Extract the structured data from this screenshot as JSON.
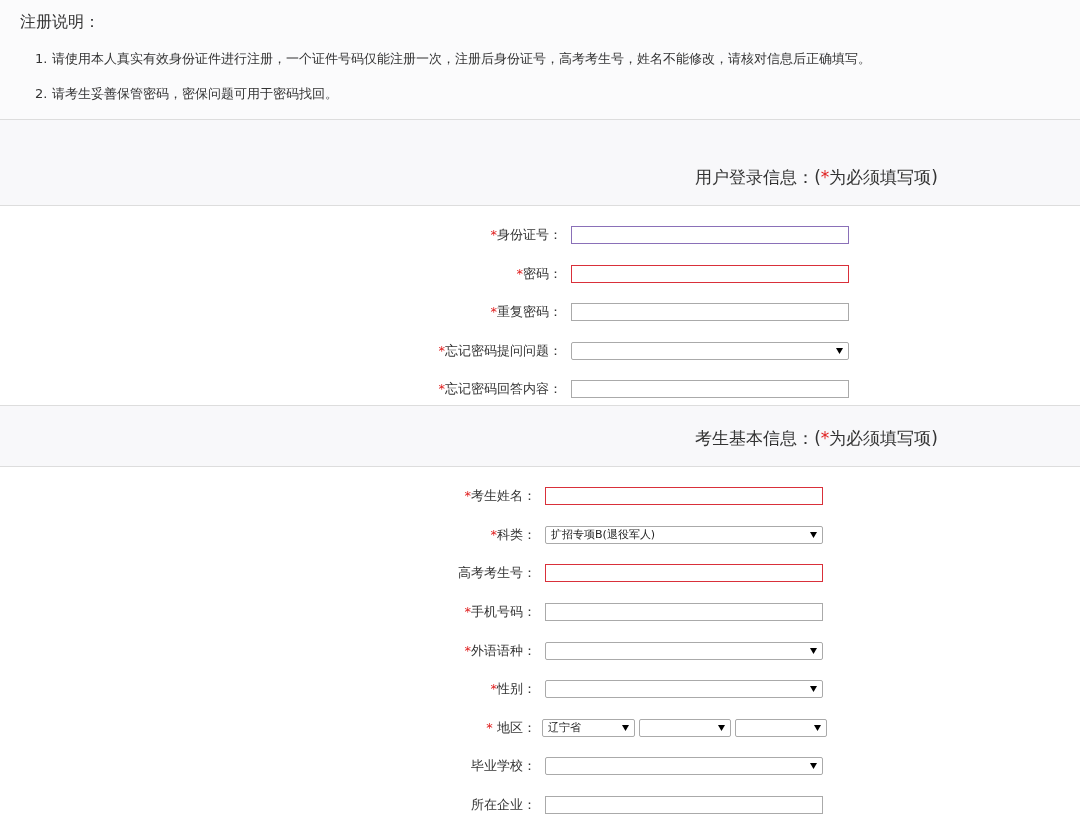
{
  "intro": {
    "title": "注册说明：",
    "items": [
      "1. 请使用本人真实有效身份证件进行注册，一个证件号码仅能注册一次，注册后身份证号，高考考生号，姓名不能修改，请核对信息后正确填写。",
      "2. 请考生妥善保管密码，密保问题可用于密码找回。"
    ]
  },
  "sections": [
    {
      "heading": {
        "prefix": "用户登录信息：(",
        "mark": "*",
        "suffix": "为必须填写项)"
      },
      "fields": [
        {
          "kind": "text",
          "mark": "*",
          "label": "身份证号：",
          "focused": true,
          "invalid": false
        },
        {
          "kind": "text",
          "mark": "*",
          "label": "密码：",
          "focused": false,
          "invalid": true
        },
        {
          "kind": "text",
          "mark": "*",
          "label": "重复密码：",
          "focused": false,
          "invalid": false
        },
        {
          "kind": "select",
          "mark": "*",
          "label": "忘记密码提问问题：",
          "focused": false,
          "invalid": false
        },
        {
          "kind": "text",
          "mark": "*",
          "label": "忘记密码回答内容：",
          "focused": false,
          "invalid": false
        }
      ]
    },
    {
      "heading": {
        "prefix": "考生基本信息：(",
        "mark": "*",
        "suffix": "为必须填写项)"
      },
      "fields": [
        {
          "kind": "text",
          "mark": "*",
          "label": "考生姓名：",
          "focused": false,
          "invalid": true
        },
        {
          "kind": "select",
          "mark": "*",
          "label": "科类：",
          "value": "扩招专项B(退役军人)",
          "focused": false,
          "invalid": false
        },
        {
          "kind": "text",
          "label": "高考考生号：",
          "focused": false,
          "invalid": true
        },
        {
          "kind": "text",
          "mark": "*",
          "label": "手机号码：",
          "focused": false,
          "invalid": false
        },
        {
          "kind": "select",
          "mark": "*",
          "label": "外语语种：",
          "focused": false,
          "invalid": false
        },
        {
          "kind": "select",
          "mark": "*",
          "label": "性别：",
          "focused": false,
          "invalid": false
        },
        {
          "kind": "region",
          "mark": "*",
          "label": "地区：",
          "province": "辽宁省"
        },
        {
          "kind": "select",
          "label": "毕业学校：",
          "focused": false,
          "invalid": false
        },
        {
          "kind": "text",
          "label": "所在企业：",
          "focused": false,
          "invalid": false
        }
      ]
    }
  ]
}
